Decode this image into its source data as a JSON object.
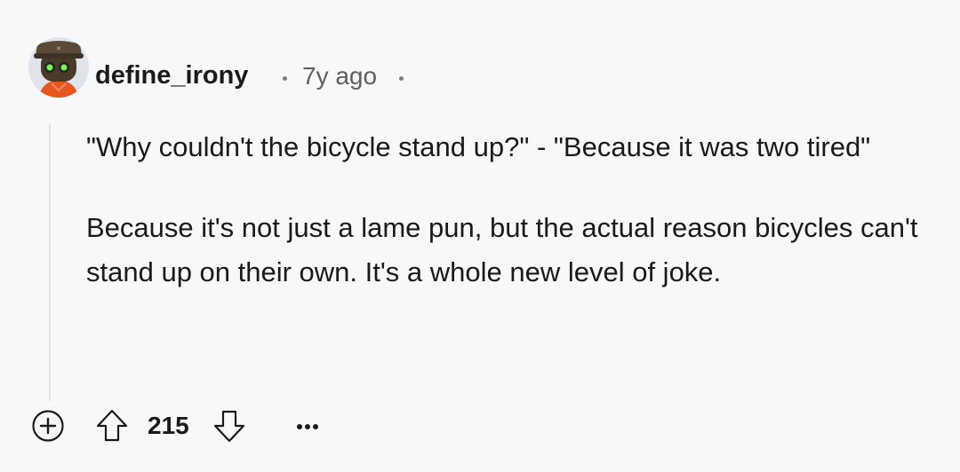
{
  "comment": {
    "author": "define_irony",
    "separator": "•",
    "timestamp": "7y ago",
    "paragraphs": [
      "\"Why couldn't the bicycle stand up?\" - \"Because it was two tired\"",
      "Because it's not just a lame pun, but the actual reason bicycles can't stand up on their own. It's a whole new level of joke."
    ],
    "score": "215"
  },
  "icons": {
    "avatar": "snoo-avatar",
    "expand": "plus-circle-icon",
    "upvote": "arrow-up-icon",
    "downvote": "arrow-down-icon",
    "more": "ellipsis-icon"
  },
  "colors": {
    "background": "#f7f8fa",
    "text": "#1a1a1b",
    "meta": "#5d5f63",
    "thread_line": "#dfe2e6"
  }
}
